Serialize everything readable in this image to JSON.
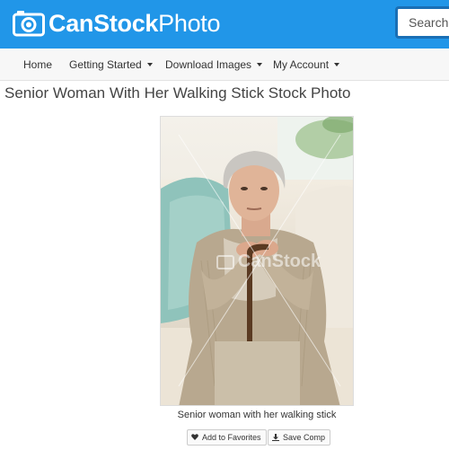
{
  "brand": {
    "name_bold": "CanStock",
    "name_light": "Photo",
    "logo_icon": "camera-icon",
    "color": "#2196e8"
  },
  "search": {
    "placeholder": "Search"
  },
  "nav": {
    "items": [
      {
        "label": "Home",
        "has_dropdown": false
      },
      {
        "label": "Getting Started",
        "has_dropdown": true
      },
      {
        "label": "Download Images",
        "has_dropdown": true
      },
      {
        "label": "My Account",
        "has_dropdown": true
      }
    ]
  },
  "page": {
    "title": "Senior Woman With Her Walking Stick Stock Photo"
  },
  "photo": {
    "watermark": "CanStock",
    "caption": "Senior woman with her walking stick"
  },
  "actions": {
    "favorites": {
      "label": "Add to Favorites",
      "icon": "heart-icon"
    },
    "save_comp": {
      "label": "Save Comp",
      "icon": "download-icon"
    }
  }
}
